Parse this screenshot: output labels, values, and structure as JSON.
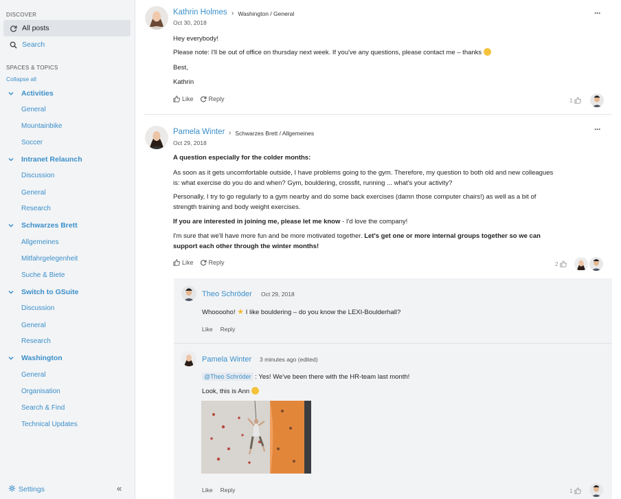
{
  "sidebar": {
    "discover_heading": "DISCOVER",
    "nav": [
      {
        "label": "All posts",
        "icon": "refresh-icon"
      },
      {
        "label": "Search",
        "icon": "search-icon"
      }
    ],
    "spaces_heading": "SPACES & TOPICS",
    "collapse_all": "Collapse all",
    "topics": [
      {
        "label": "Activities",
        "items": [
          "General",
          "Mountainbike",
          "Soccer"
        ]
      },
      {
        "label": "Intranet Relaunch",
        "items": [
          "Discussion",
          "General",
          "Research"
        ]
      },
      {
        "label": "Schwarzes Brett",
        "items": [
          "Allgemeines",
          "Mitfahrgelegenheit",
          "Suche & Biete"
        ]
      },
      {
        "label": "Switch to GSuite",
        "items": [
          "Discussion",
          "General",
          "Research"
        ]
      },
      {
        "label": "Washington",
        "items": [
          "General",
          "Organisation",
          "Search & Find",
          "Technical Updates"
        ]
      }
    ],
    "settings": "Settings",
    "collapse_icon": "«"
  },
  "posts": [
    {
      "author": "Kathrin Holmes",
      "breadcrumb": "Washington / General",
      "date": "Oct 30, 2018",
      "lines": [
        "Hey everybody!",
        "Please note: I'll be out of office on thursday next week. If you've any questions, please contact me – thanks",
        "Best,",
        "Kathrin"
      ],
      "like_label": "Like",
      "reply_label": "Reply",
      "like_count": "1"
    },
    {
      "author": "Pamela Winter",
      "breadcrumb": "Schwarzes Brett / Allgemeines",
      "date": "Oct 29, 2018",
      "heading": "A question especially for the colder months:",
      "para1_l1": "As soon as it gets uncomfortable outside, I have problems going to the gym. Therefore, my question to both old and new colleagues",
      "para1_l2": "is: what exercise do you do and when? Gym, bouldering, crossfit, running ... what's your activity?",
      "para2_l1": "Personally, I try to go regularly to a gym nearby and do some back exercises (damn those computer chairs!) as well as a bit of",
      "para2_l2": "strength training and body weight exercises.",
      "para3_bold": "If you are interested in joining me, please let me know",
      "para3_rest": " - I'd love the company!",
      "para4_l1_start": "I'm sure that we'll have more fun and be more motivated together. ",
      "para4_l1_bold": "Let's get one or more internal groups together so we can",
      "para4_l2_bold": "support each other through the winter months!",
      "like_label": "Like",
      "reply_label": "Reply",
      "like_count": "2"
    }
  ],
  "comments": [
    {
      "author": "Theo Schröder",
      "date": "Oct 29, 2018",
      "text_pre": "Whooooho! ",
      "text_post": " I like bouldering – do you know the LEXI-Boulderhall?",
      "like_label": "Like",
      "reply_label": "Reply"
    },
    {
      "author": "Pamela Winter",
      "date": "3 minutes ago (edited)",
      "mention": "@Theo Schröder",
      "text_after_mention": " : Yes! We've been there with the HR-team last month!",
      "line2": "Look, this is Ann",
      "like_label": "Like",
      "reply_label": "Reply",
      "like_count": "1"
    }
  ],
  "colors": {
    "accent": "#3a8fc9",
    "sidebar_bg": "#f3f4f6",
    "comment_bg": "#f2f3f5"
  }
}
